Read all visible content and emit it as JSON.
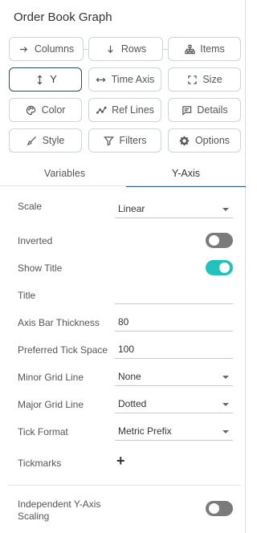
{
  "panel": {
    "title": "Order Book Graph"
  },
  "buttons": {
    "columns": "Columns",
    "rows": "Rows",
    "items": "Items",
    "y": "Y",
    "time_axis": "Time Axis",
    "size": "Size",
    "color": "Color",
    "ref_lines": "Ref Lines",
    "details": "Details",
    "style": "Style",
    "filters": "Filters",
    "options": "Options"
  },
  "tabs": {
    "variables": "Variables",
    "y_axis": "Y-Axis",
    "selected": "Y-Axis"
  },
  "settings": {
    "scale": {
      "label": "Scale",
      "value": "Linear"
    },
    "inverted": {
      "label": "Inverted",
      "on": false
    },
    "show_title": {
      "label": "Show Title",
      "on": true
    },
    "title": {
      "label": "Title",
      "value": ""
    },
    "axis_bar_thickness": {
      "label": "Axis Bar Thickness",
      "value": "80"
    },
    "preferred_tick_space": {
      "label": "Preferred Tick Space",
      "value": "100"
    },
    "minor_grid_line": {
      "label": "Minor Grid Line",
      "value": "None"
    },
    "major_grid_line": {
      "label": "Major Grid Line",
      "value": "Dotted"
    },
    "tick_format": {
      "label": "Tick Format",
      "value": "Metric Prefix"
    },
    "tickmarks": {
      "label": "Tickmarks",
      "add_symbol": "+"
    },
    "independent_scaling": {
      "label_line1": "Independent Y-Axis",
      "label_line2": "Scaling",
      "on": false
    }
  },
  "colors": {
    "accent": "#22c1bd",
    "active_border": "#2a4a66",
    "tab_underline": "#2a5d7a"
  }
}
